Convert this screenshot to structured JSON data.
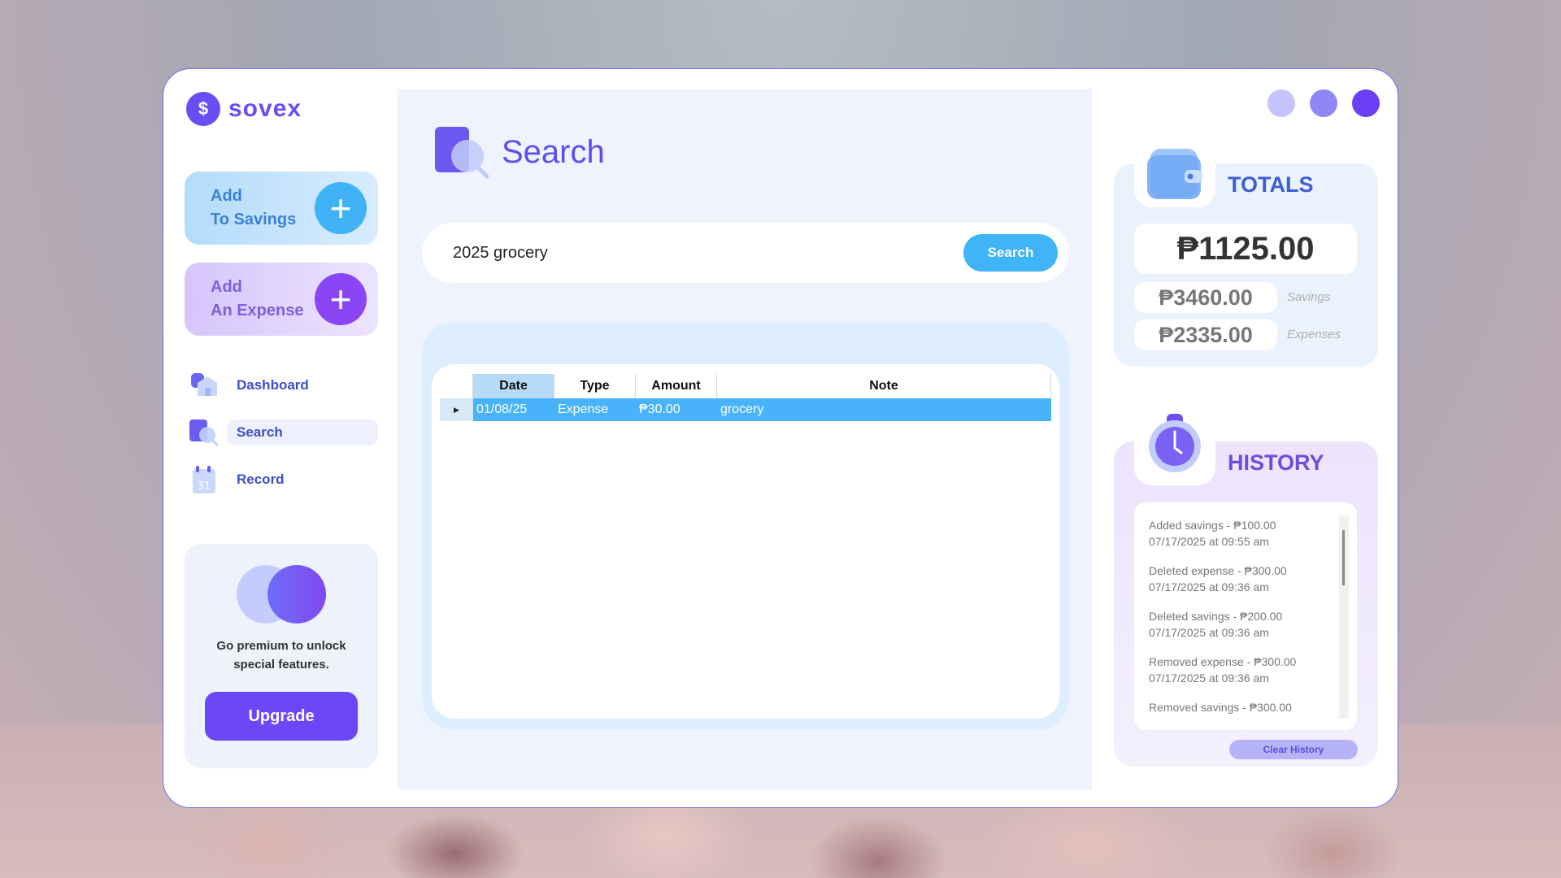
{
  "app": {
    "logo_symbol": "$",
    "name": "sovex",
    "brand_color": "#6b4df5"
  },
  "sidebar": {
    "add_savings": {
      "line1": "Add",
      "line2": "To Savings",
      "icon": "plus-icon"
    },
    "add_expense": {
      "line1": "Add",
      "line2": "An Expense",
      "icon": "plus-icon"
    },
    "nav": [
      {
        "label": "Dashboard",
        "icon": "home-icon",
        "active": false
      },
      {
        "label": "Search",
        "icon": "search-icon",
        "active": true
      },
      {
        "label": "Record",
        "icon": "calendar-icon",
        "icon_text": "31",
        "active": false
      }
    ],
    "premium": {
      "text": "Go premium to unlock special features.",
      "button": "Upgrade"
    }
  },
  "main": {
    "title": "Search",
    "search": {
      "value": "2025 grocery",
      "button": "Search"
    },
    "table": {
      "columns": [
        "Date",
        "Type",
        "Amount",
        "Note"
      ],
      "rows": [
        {
          "date": "01/08/25",
          "type": "Expense",
          "amount": "₱30.00",
          "note": "grocery",
          "selected": true
        }
      ]
    }
  },
  "window_controls": {
    "colors": [
      "#c5c3fb",
      "#8e87f6",
      "#6b3ff4"
    ]
  },
  "totals": {
    "title": "TOTALS",
    "icon": "wallet-icon",
    "total": "₱1125.00",
    "savings": "₱3460.00",
    "savings_label": "Savings",
    "expenses": "₱2335.00",
    "expenses_label": "Expenses"
  },
  "history": {
    "title": "HISTORY",
    "icon": "clock-icon",
    "entries": [
      {
        "action": "Added savings - ₱100.00",
        "time": "07/17/2025 at 09:55 am"
      },
      {
        "action": "Deleted expense - ₱300.00",
        "time": "07/17/2025 at 09:36 am"
      },
      {
        "action": "Deleted savings - ₱200.00",
        "time": "07/17/2025 at 09:36 am"
      },
      {
        "action": "Removed expense - ₱300.00",
        "time": "07/17/2025 at 09:36 am"
      },
      {
        "action": "Removed savings - ₱300.00",
        "time": ""
      }
    ],
    "clear_button": "Clear History"
  }
}
